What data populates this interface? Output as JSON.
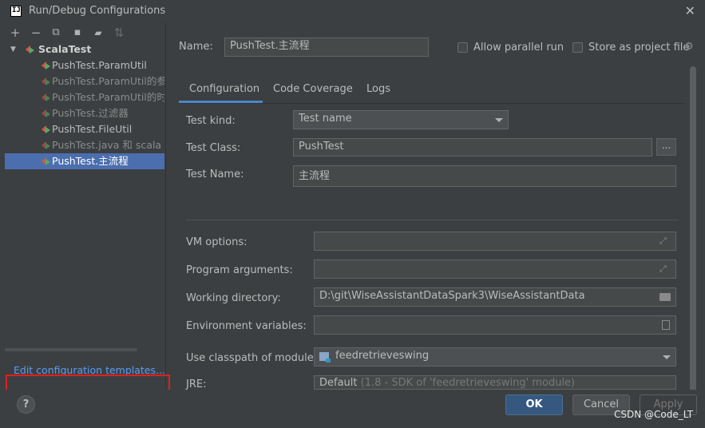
{
  "window": {
    "title": "Run/Debug Configurations",
    "app_icon_text": "IJ"
  },
  "toolbar": {
    "add": "+",
    "remove": "−",
    "copy": "⧉",
    "save": "▪",
    "folder": "▰",
    "sort": "⇅"
  },
  "tree": {
    "root": "ScalaTest",
    "items": [
      {
        "label": "PushTest.ParamUtil",
        "style": "normal"
      },
      {
        "label": "PushTest.ParamUtil的参数",
        "style": "dim"
      },
      {
        "label": "PushTest.ParamUtil的时间",
        "style": "dim"
      },
      {
        "label": "PushTest.过滤器",
        "style": "dim"
      },
      {
        "label": "PushTest.FileUtil",
        "style": "normal"
      },
      {
        "label": "PushTest.java 和 scala 类",
        "style": "dim"
      },
      {
        "label": "PushTest.主流程",
        "style": "selected"
      }
    ]
  },
  "edit_templates_link": "Edit configuration templates...",
  "name": {
    "label": "Name:",
    "value": "PushTest.主流程"
  },
  "allow_parallel": {
    "label": "Allow parallel run",
    "checked": false
  },
  "store_project": {
    "label": "Store as project file",
    "checked": false
  },
  "tabs": [
    "Configuration",
    "Code Coverage",
    "Logs"
  ],
  "active_tab": "Configuration",
  "form": {
    "test_kind": {
      "label": "Test kind:",
      "value": "Test name"
    },
    "test_class": {
      "label": "Test Class:",
      "value": "PushTest",
      "button": "..."
    },
    "test_name": {
      "label": "Test Name:",
      "value": "主流程"
    },
    "vm_options": {
      "label": "VM options:",
      "value": ""
    },
    "program_arguments": {
      "label": "Program arguments:",
      "value": ""
    },
    "working_directory": {
      "label": "Working directory:",
      "value": "D:\\git\\WiseAssistantDataSpark3\\WiseAssistantData"
    },
    "environment_variables": {
      "label": "Environment variables:",
      "value": ""
    },
    "classpath_module": {
      "label": "Use classpath of module:",
      "value": "feedretrieveswing"
    },
    "jre": {
      "label": "JRE:",
      "value": "Default",
      "hint": "(1.8 - SDK of 'feedretrieveswing' module)"
    }
  },
  "buttons": {
    "help": "?",
    "ok": "OK",
    "cancel": "Cancel",
    "apply": "Apply"
  },
  "watermark": "CSDN @Code_LT",
  "colors": {
    "accent": "#4a88c7",
    "selection": "#4b6eaf",
    "link": "#589df6",
    "highlight_box": "#e02020"
  }
}
